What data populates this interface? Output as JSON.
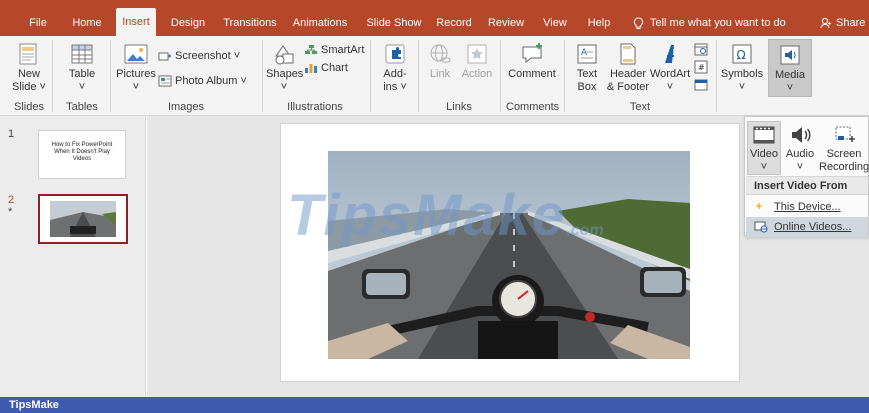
{
  "tabs": [
    {
      "label": "File",
      "active": false
    },
    {
      "label": "Home",
      "active": false
    },
    {
      "label": "Insert",
      "active": true
    },
    {
      "label": "Design",
      "active": false
    },
    {
      "label": "Transitions",
      "active": false
    },
    {
      "label": "Animations",
      "active": false
    },
    {
      "label": "Slide Show",
      "active": false
    },
    {
      "label": "Record",
      "active": false
    },
    {
      "label": "Review",
      "active": false
    },
    {
      "label": "View",
      "active": false
    },
    {
      "label": "Help",
      "active": false
    }
  ],
  "tell_me": "Tell me what you want to do",
  "share": "Share",
  "ribbon": {
    "slides": {
      "new_slide": "New",
      "new_slide_2": "Slide ˅",
      "group": "Slides"
    },
    "tables": {
      "table": "Table",
      "group": "Tables"
    },
    "images": {
      "pictures": "Pictures",
      "screenshot": "Screenshot ˅",
      "photo_album": "Photo Album",
      "group": "Images"
    },
    "illustrations": {
      "shapes": "Shapes",
      "smartart": "SmartArt",
      "chart": "Chart",
      "group": "Illustrations"
    },
    "addins": {
      "label_1": "Add-",
      "label_2": "ins ˅"
    },
    "links": {
      "link": "Link",
      "action": "Action",
      "group": "Links"
    },
    "comments": {
      "comment": "Comment",
      "group": "Comments"
    },
    "text": {
      "text_box_1": "Text",
      "text_box_2": "Box",
      "header_footer_1": "Header",
      "header_footer_2": "& Footer",
      "wordart": "WordArt",
      "group": "Text"
    },
    "symbols": {
      "label": "Symbols"
    },
    "media": {
      "label": "Media"
    }
  },
  "slides_pane": {
    "slide1_number": "1",
    "slide1_title": "How to Fix PowerPoint When It Doesn't Play Videos",
    "slide2_number": "2",
    "slide2_marker": "*"
  },
  "canvas": {
    "watermark": "TipsMake",
    "watermark_suffix": ".com"
  },
  "media_menu": {
    "video": "Video",
    "audio": "Audio",
    "screen_recording_1": "Screen",
    "screen_recording_2": "Recording",
    "insert_video_from": "Insert Video From",
    "this_device": "This Device...",
    "online_videos": "Online Videos..."
  },
  "status_bar": "TipsMake",
  "colors": {
    "accent": "#b7472a",
    "ribbon_bg": "#f3f3f3",
    "status_bar": "#3e5bb0",
    "selected_slide_border": "#8b2224"
  }
}
